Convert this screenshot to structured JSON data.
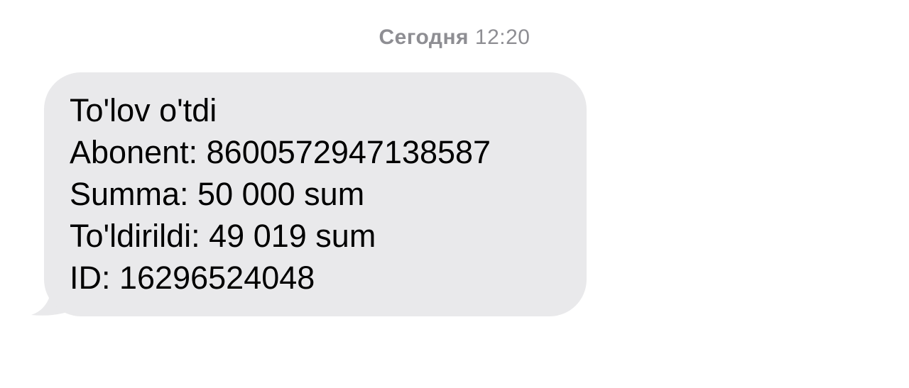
{
  "timestamp": {
    "day": "Сегодня",
    "time": "12:20"
  },
  "message": {
    "lines": [
      "To'lov o'tdi",
      "Abonent: 8600572947138587",
      "Summa: 50 000 sum",
      "To'ldirildi: 49 019 sum",
      "ID: 16296524048"
    ]
  },
  "colors": {
    "background": "#ffffff",
    "bubble": "#e9e9eb",
    "timestamp": "#8e8e93",
    "text": "#000000"
  }
}
